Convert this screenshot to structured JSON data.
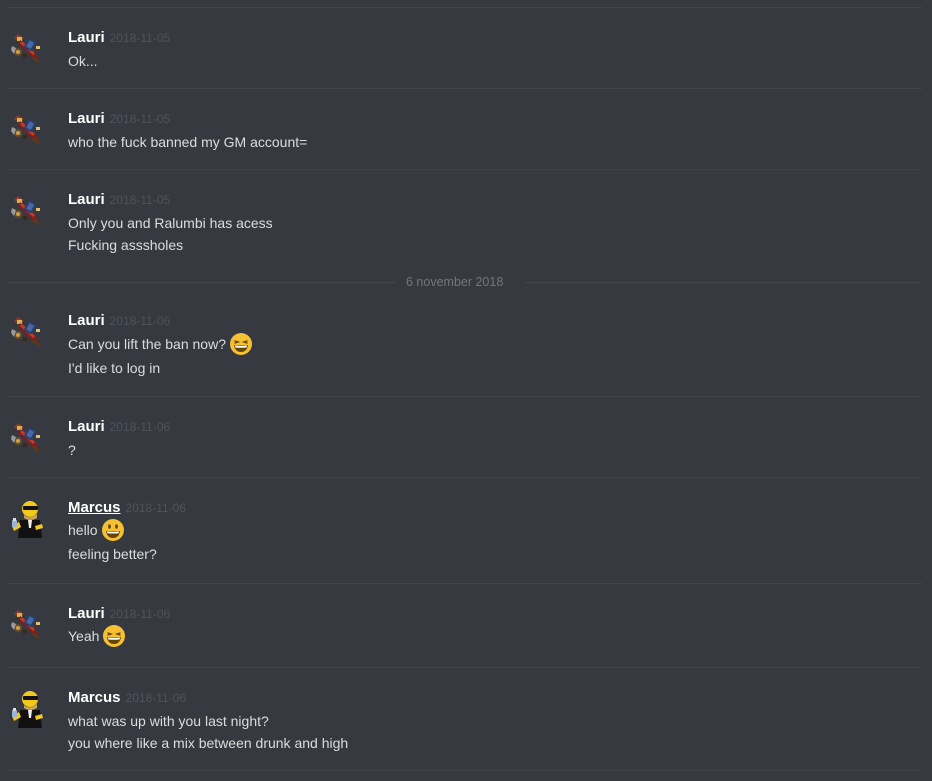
{
  "users": {
    "lauri": {
      "name": "Lauri",
      "avatar_icon": "sword-shield-sprite-icon"
    },
    "marcus": {
      "name": "Marcus",
      "avatar_icon": "homer-sunglasses-icon"
    }
  },
  "messages": [
    {
      "author": "Lauri",
      "timestamp": "2018-11-05",
      "lines": [
        "Ok..."
      ]
    },
    {
      "author": "Lauri",
      "timestamp": "2018-11-05",
      "lines": [
        "who the fuck banned my GM account="
      ]
    },
    {
      "author": "Lauri",
      "timestamp": "2018-11-05",
      "lines": [
        "Only you and Ralumbi has acess",
        "Fucking asssholes"
      ]
    },
    {
      "author": "Lauri",
      "timestamp": "2018-11-06",
      "lines": [
        "Can you lift the ban now?",
        "I'd like to log in"
      ],
      "emoji": "grinning-squint-emoji"
    },
    {
      "author": "Lauri",
      "timestamp": "2018-11-06",
      "lines": [
        "?"
      ]
    },
    {
      "author": "Marcus",
      "timestamp": "2018-11-06",
      "lines": [
        "hello",
        "feeling better?"
      ],
      "emoji": "smiley-emoji"
    },
    {
      "author": "Lauri",
      "timestamp": "2018-11-06",
      "lines": [
        "Yeah"
      ],
      "emoji": "grinning-squint-emoji"
    },
    {
      "author": "Marcus",
      "timestamp": "2018-11-06",
      "lines": [
        "what was up with you last night?",
        "you where like a mix between drunk and high"
      ]
    }
  ],
  "date_separator": {
    "label": "6 november 2018"
  },
  "colors": {
    "background": "#36393f",
    "divider": "#40434a",
    "author": "#ffffff",
    "timestamp": "#4f535b",
    "text": "#dcddde",
    "emoji_yellow": "#f5c033"
  }
}
